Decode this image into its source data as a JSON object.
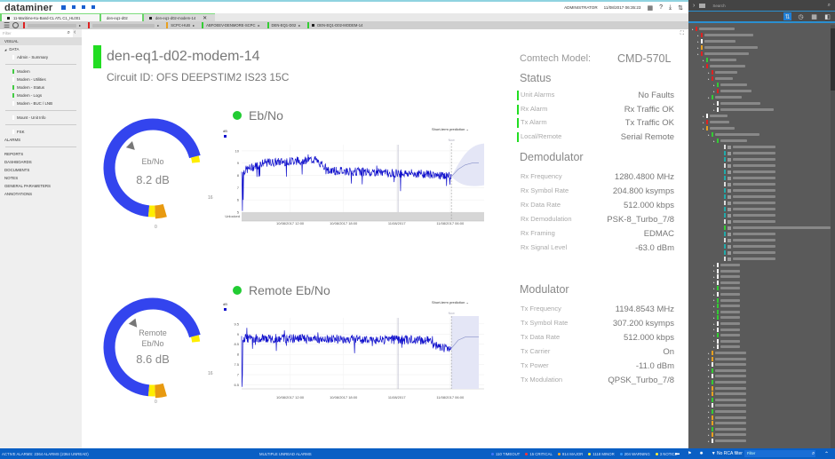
{
  "topbar": {
    "app_name": "dataminer",
    "user": "ADMINISTRATOR",
    "datetime": "11/08/2017 06:35:23",
    "icons": [
      "apps-icon",
      "help-icon",
      "download-icon",
      "swap-icon"
    ]
  },
  "tabs": [
    {
      "label": "11-Maritime-Ku-Band-CL ATL C1_HL001",
      "active": false
    },
    {
      "label": "den-eq1-d02",
      "active": false
    },
    {
      "label": "den-eq1-d02-modem-14",
      "active": true
    }
  ],
  "breadcrumbs": [
    {
      "label": "",
      "color": "#dd2222",
      "blurred": true
    },
    {
      "label": "",
      "color": "#dd2222",
      "blurred": true
    },
    {
      "label": "SCPC-HUB",
      "color": "#e8a020"
    },
    {
      "label": "ABFOEEV-DENMORE-SCPC",
      "color": "#33cc33"
    },
    {
      "label": "DEN-EQ1-D02",
      "color": "#33cc33"
    },
    {
      "label": "DEN-EQ1-D02-MODEM-14",
      "color": "#33cc33",
      "square": true
    }
  ],
  "sidebar": {
    "filter_placeholder": "Filter",
    "visual_label": "VISUAL",
    "data_label": "DATA",
    "items": [
      {
        "label": "Admin - Summary",
        "status": "white"
      },
      {
        "label": "Modem",
        "status": "green"
      },
      {
        "label": "Modem - Utilities",
        "status": "white"
      },
      {
        "label": "Modem - Status",
        "status": "green"
      },
      {
        "label": "Modem - Logs",
        "status": "green"
      },
      {
        "label": "Modem - BUC / LNB",
        "status": "white"
      },
      {
        "label": "Mount - Unit Info",
        "status": "white"
      },
      {
        "label": "FSK",
        "status": "white"
      }
    ],
    "alarms_label": "ALARMS",
    "sections": [
      "REPORTS",
      "DASHBOARDS",
      "DOCUMENTS",
      "NOTES",
      "GENERAL PARAMETERS",
      "ANNOTATIONS"
    ]
  },
  "device": {
    "name": "den-eq1-d02-modem-14",
    "circuit": "Circuit ID: OFS DEEPSTIM2 IS23 15C",
    "status_color": "#22dd22"
  },
  "gauges": [
    {
      "label": "Eb/No",
      "value": "8.2 dB",
      "value_num": 8.2,
      "min": "0",
      "max": "16"
    },
    {
      "label": "Remote Eb/No",
      "value": "8.6 dB",
      "value_num": 8.6,
      "min": "0",
      "max": "16"
    }
  ],
  "charts_meta": [
    {
      "title": "Eb/No",
      "prediction_label": "Short-term prediction",
      "now_label": "Now",
      "unit": "dB"
    },
    {
      "title": "Remote Eb/No",
      "prediction_label": "Short-term prediction",
      "now_label": "Now",
      "unit": "dB"
    }
  ],
  "chart_data": [
    {
      "type": "line",
      "title": "Eb/No",
      "ylabel": "dB",
      "ylim": [
        5,
        10.5
      ],
      "yticks": [
        "10",
        "9",
        "8",
        "7",
        "6",
        "5"
      ],
      "extra_row_label": "Unlocked",
      "xticks": [
        "10/08/2017 12:00",
        "10/08/2017 18:00",
        "11/08/2017",
        "11/08/2017 06:00"
      ],
      "series": [
        {
          "name": "Eb/No",
          "segments": [
            {
              "from": 0.0,
              "to": 0.1,
              "start": 8.3,
              "end": 9.0
            },
            {
              "from": 0.1,
              "to": 0.35,
              "start": 9.0,
              "end": 9.3
            },
            {
              "from": 0.35,
              "to": 0.4,
              "start": 9.3,
              "end": 8.6
            },
            {
              "from": 0.4,
              "to": 0.9,
              "start": 8.4,
              "end": 8.1
            },
            {
              "from": 0.9,
              "to": 1.0,
              "start": 8.1,
              "end": 7.9
            }
          ]
        },
        {
          "name": "Prediction",
          "values": [
            7.9,
            8.5,
            8.85,
            9.0,
            9.0
          ]
        }
      ],
      "grid": true,
      "legend": "top-left"
    },
    {
      "type": "line",
      "title": "Remote Eb/No",
      "ylabel": "dB",
      "ylim": [
        6.3,
        9.8
      ],
      "yticks": [
        "9.5",
        "9",
        "8.5",
        "8",
        "7.5",
        "7",
        "6.5"
      ],
      "xticks": [
        "10/08/2017 12:00",
        "10/08/2017 18:00",
        "11/08/2017",
        "11/08/2017 06:00"
      ],
      "series": [
        {
          "name": "Remote Eb/No",
          "segments": [
            {
              "from": 0.0,
              "to": 0.9,
              "start": 8.8,
              "end": 8.7
            },
            {
              "from": 0.9,
              "to": 1.0,
              "start": 8.5,
              "end": 8.2
            }
          ]
        },
        {
          "name": "Prediction",
          "values": [
            8.3,
            8.7,
            8.85,
            8.85,
            8.85
          ]
        }
      ],
      "grid": true,
      "legend": "top-left"
    }
  ],
  "info": {
    "model_label": "Comtech Model:",
    "model_value": "CMD-570L",
    "status_title": "Status",
    "status": [
      {
        "k": "Unit Alarms",
        "v": "No Faults"
      },
      {
        "k": "Rx Alarm",
        "v": "Rx Traffic OK"
      },
      {
        "k": "Tx Alarm",
        "v": "Tx Traffic OK"
      },
      {
        "k": "Local/Remote",
        "v": "Serial Remote"
      }
    ],
    "demod_title": "Demodulator",
    "demod": [
      {
        "k": "Rx Frequency",
        "v": "1280.4800 MHz"
      },
      {
        "k": "Rx Symbol Rate",
        "v": "204.800 ksymps"
      },
      {
        "k": "Rx Data Rate",
        "v": "512.000 kbps"
      },
      {
        "k": "Rx Demodulation",
        "v": "PSK-8_Turbo_7/8"
      },
      {
        "k": "Rx Framing",
        "v": "EDMAC"
      },
      {
        "k": "Rx Signal Level",
        "v": "-63.0 dBm"
      }
    ],
    "mod_title": "Modulator",
    "mod": [
      {
        "k": "Tx Frequency",
        "v": "1194.8543 MHz"
      },
      {
        "k": "Tx Symbol Rate",
        "v": "307.200 ksymps"
      },
      {
        "k": "Tx Data Rate",
        "v": "512.000 kbps"
      },
      {
        "k": "Tx Carrier",
        "v": "On"
      },
      {
        "k": "Tx Power",
        "v": "-11.0 dBm"
      },
      {
        "k": "Tx Modulation",
        "v": "QPSK_Turbo_7/8"
      }
    ]
  },
  "surveyor": {
    "search_placeholder": "Search"
  },
  "statusbar": {
    "active_alarms": "ACTIVE ALARMS: 2364 ALARMS (2364 UNREAD)",
    "middle": "MULTIPLE UNREAD ALARMS",
    "counts": [
      {
        "label": "110 TIMEOUT",
        "color": "#4477ff"
      },
      {
        "label": "15 CRITICAL",
        "color": "#ff3333"
      },
      {
        "label": "914 MAJOR",
        "color": "#ffaa22"
      },
      {
        "label": "1118 MINOR",
        "color": "#ffee33"
      },
      {
        "label": "204 WARNING",
        "color": "#3399ff"
      },
      {
        "label": "3 NOTICE",
        "color": "#ffee33"
      }
    ],
    "filter_label": "No RCA filter",
    "filter_placeholder": "Filter"
  }
}
